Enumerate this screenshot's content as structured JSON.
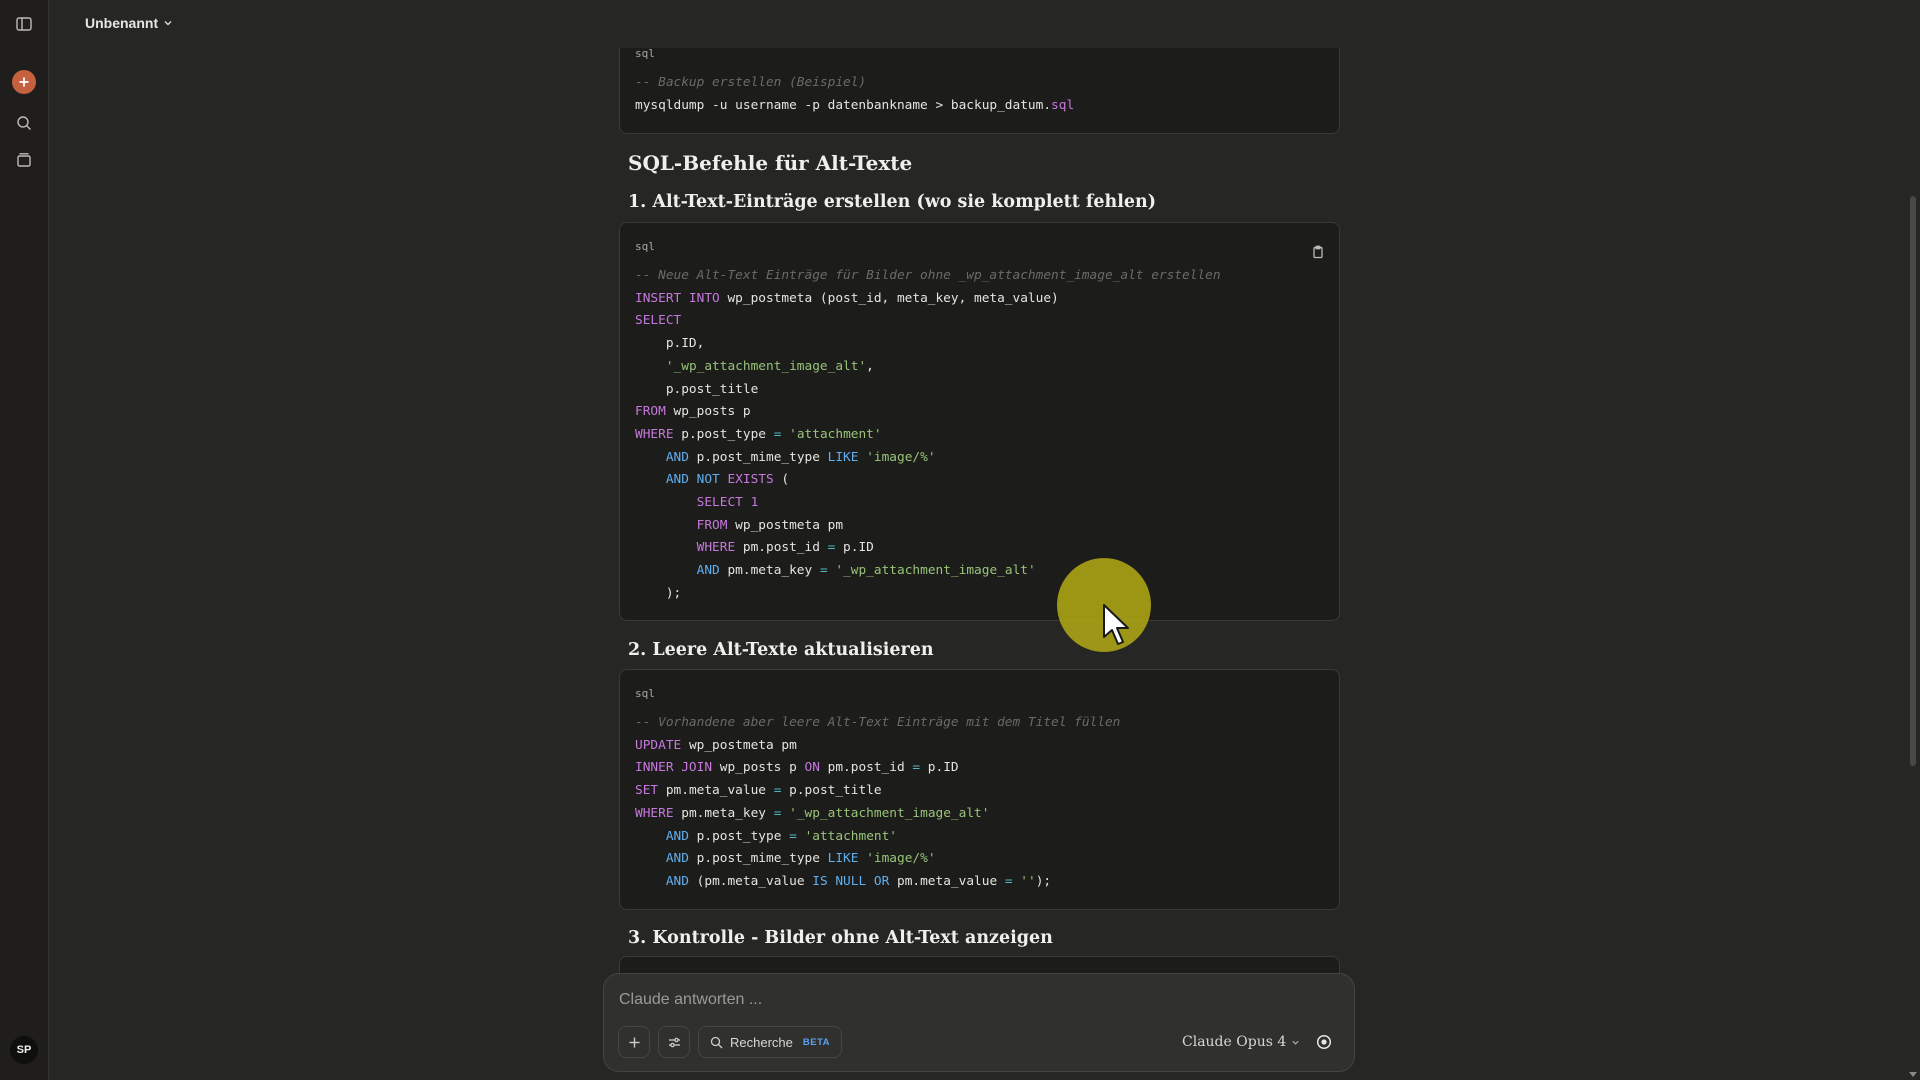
{
  "window": {
    "title": "Unbenannt"
  },
  "sidebar": {
    "avatar_initials": "SP"
  },
  "content": {
    "block0": {
      "lang": "sql",
      "lines": [
        [
          {
            "t": "-- Backup erstellen (Beispiel)",
            "c": "cm"
          }
        ],
        [
          {
            "t": "mysqldump -u username -p datenbankname > backup_datum.",
            "c": ""
          },
          {
            "t": "sql",
            "c": "kw"
          }
        ]
      ]
    },
    "heading_main": "SQL-Befehle für Alt-Texte",
    "heading_1": "1. Alt-Text-Einträge erstellen (wo sie komplett fehlen)",
    "block1": {
      "lang": "sql",
      "lines": [
        [
          {
            "t": "-- Neue Alt-Text Einträge für Bilder ohne _wp_attachment_image_alt erstellen",
            "c": "cm"
          }
        ],
        [
          {
            "t": "INSERT INTO",
            "c": "kw"
          },
          {
            "t": " wp_postmeta (post_id, meta_key, meta_value)",
            "c": ""
          }
        ],
        [
          {
            "t": "SELECT",
            "c": "kw"
          }
        ],
        [
          {
            "t": "    p.ID,",
            "c": ""
          }
        ],
        [
          {
            "t": "    ",
            "c": ""
          },
          {
            "t": "'_wp_attachment_image_alt'",
            "c": "str"
          },
          {
            "t": ",",
            "c": ""
          }
        ],
        [
          {
            "t": "    p.post_title",
            "c": ""
          }
        ],
        [
          {
            "t": "FROM",
            "c": "kw"
          },
          {
            "t": " wp_posts p",
            "c": ""
          }
        ],
        [
          {
            "t": "WHERE",
            "c": "kw"
          },
          {
            "t": " p.post_type ",
            "c": ""
          },
          {
            "t": "=",
            "c": "op"
          },
          {
            "t": " ",
            "c": ""
          },
          {
            "t": "'attachment'",
            "c": "str"
          }
        ],
        [
          {
            "t": "    ",
            "c": ""
          },
          {
            "t": "AND",
            "c": "kw2"
          },
          {
            "t": " p.post_mime_type ",
            "c": ""
          },
          {
            "t": "LIKE",
            "c": "kw2"
          },
          {
            "t": " ",
            "c": ""
          },
          {
            "t": "'image/%'",
            "c": "str"
          }
        ],
        [
          {
            "t": "    ",
            "c": ""
          },
          {
            "t": "AND NOT",
            "c": "kw2"
          },
          {
            "t": " ",
            "c": ""
          },
          {
            "t": "EXISTS",
            "c": "kw"
          },
          {
            "t": " (",
            "c": ""
          }
        ],
        [
          {
            "t": "        ",
            "c": ""
          },
          {
            "t": "SELECT",
            "c": "kw"
          },
          {
            "t": " ",
            "c": ""
          },
          {
            "t": "1",
            "c": "kw"
          }
        ],
        [
          {
            "t": "        ",
            "c": ""
          },
          {
            "t": "FROM",
            "c": "kw"
          },
          {
            "t": " wp_postmeta pm",
            "c": ""
          }
        ],
        [
          {
            "t": "        ",
            "c": ""
          },
          {
            "t": "WHERE",
            "c": "kw"
          },
          {
            "t": " pm.post_id ",
            "c": ""
          },
          {
            "t": "=",
            "c": "op"
          },
          {
            "t": " p.ID",
            "c": ""
          }
        ],
        [
          {
            "t": "        ",
            "c": ""
          },
          {
            "t": "AND",
            "c": "kw2"
          },
          {
            "t": " pm.meta_key ",
            "c": ""
          },
          {
            "t": "=",
            "c": "op"
          },
          {
            "t": " ",
            "c": ""
          },
          {
            "t": "'_wp_attachment_image_alt'",
            "c": "str"
          }
        ],
        [
          {
            "t": "    );",
            "c": ""
          }
        ]
      ]
    },
    "heading_2": "2. Leere Alt-Texte aktualisieren",
    "block2": {
      "lang": "sql",
      "lines": [
        [
          {
            "t": "-- Vorhandene aber leere Alt-Text Einträge mit dem Titel füllen",
            "c": "cm"
          }
        ],
        [
          {
            "t": "UPDATE",
            "c": "kw"
          },
          {
            "t": " wp_postmeta pm",
            "c": ""
          }
        ],
        [
          {
            "t": "INNER JOIN",
            "c": "kw"
          },
          {
            "t": " wp_posts p ",
            "c": ""
          },
          {
            "t": "ON",
            "c": "kw"
          },
          {
            "t": " pm.post_id ",
            "c": ""
          },
          {
            "t": "=",
            "c": "op"
          },
          {
            "t": " p.ID",
            "c": ""
          }
        ],
        [
          {
            "t": "SET",
            "c": "kw"
          },
          {
            "t": " pm.meta_value ",
            "c": ""
          },
          {
            "t": "=",
            "c": "op"
          },
          {
            "t": " p.post_title",
            "c": ""
          }
        ],
        [
          {
            "t": "WHERE",
            "c": "kw"
          },
          {
            "t": " pm.meta_key ",
            "c": ""
          },
          {
            "t": "=",
            "c": "op"
          },
          {
            "t": " ",
            "c": ""
          },
          {
            "t": "'_wp_attachment_image_alt'",
            "c": "str"
          }
        ],
        [
          {
            "t": "    ",
            "c": ""
          },
          {
            "t": "AND",
            "c": "kw2"
          },
          {
            "t": " p.post_type ",
            "c": ""
          },
          {
            "t": "=",
            "c": "op"
          },
          {
            "t": " ",
            "c": ""
          },
          {
            "t": "'attachment'",
            "c": "str"
          }
        ],
        [
          {
            "t": "    ",
            "c": ""
          },
          {
            "t": "AND",
            "c": "kw2"
          },
          {
            "t": " p.post_mime_type ",
            "c": ""
          },
          {
            "t": "LIKE",
            "c": "kw2"
          },
          {
            "t": " ",
            "c": ""
          },
          {
            "t": "'image/%'",
            "c": "str"
          }
        ],
        [
          {
            "t": "    ",
            "c": ""
          },
          {
            "t": "AND",
            "c": "kw2"
          },
          {
            "t": " (pm.meta_value ",
            "c": ""
          },
          {
            "t": "IS NULL OR",
            "c": "kw2"
          },
          {
            "t": " pm.meta_value ",
            "c": ""
          },
          {
            "t": "=",
            "c": "op"
          },
          {
            "t": " ",
            "c": ""
          },
          {
            "t": "''",
            "c": "str"
          },
          {
            "t": ");",
            "c": ""
          }
        ]
      ]
    },
    "heading_3": "3. Kontrolle - Bilder ohne Alt-Text anzeigen"
  },
  "composer": {
    "placeholder": "Claude antworten ...",
    "research_label": "Recherche",
    "beta_badge": "BETA",
    "model_label": "Claude Opus 4"
  },
  "icons": {
    "sidebar_toggle": "sidebar-toggle-icon",
    "new_chat": "plus-icon",
    "search": "search-icon",
    "chats": "chats-icon",
    "copy": "copy-icon",
    "settings": "sliders-icon",
    "record": "record-icon"
  },
  "colors": {
    "accent": "#c6613f",
    "keyword": "#c678dd",
    "keyword_alt": "#61afef",
    "string": "#98c379",
    "comment": "#6c6a64"
  }
}
